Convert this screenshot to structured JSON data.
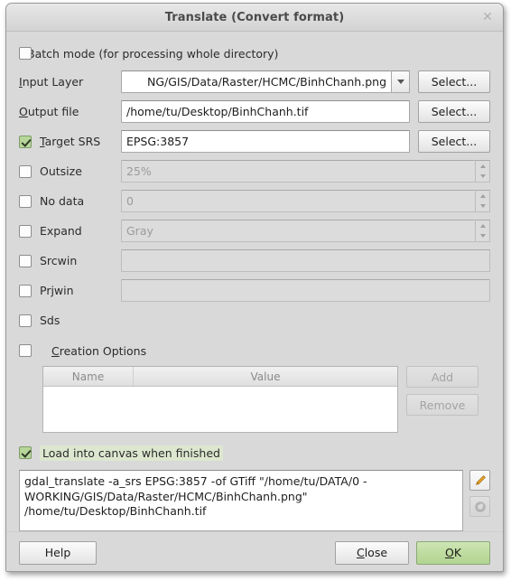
{
  "window": {
    "title": "Translate (Convert format)",
    "close_icon": "close-icon",
    "close_glyph": "✕"
  },
  "form": {
    "batch_mode": {
      "label": "Batch mode (for processing whole directory)",
      "checked": false
    },
    "input_layer": {
      "label": "Input Layer",
      "mnemonic": "I",
      "label_rest": "nput Layer",
      "value": "NG/GIS/Data/Raster/HCMC/BinhChanh.png",
      "select_label": "Select..."
    },
    "output_file": {
      "label": "Output file",
      "mnemonic": "O",
      "label_rest": "utput file",
      "value": "/home/tu/Desktop/BinhChanh.tif",
      "select_label": "Select..."
    },
    "target_srs": {
      "label": "Target SRS",
      "mnemonic": "T",
      "label_rest": "arget SRS",
      "checked": true,
      "value": "EPSG:3857",
      "select_label": "Select..."
    },
    "outsize": {
      "label": "Outsize",
      "checked": false,
      "value": "25%",
      "enabled": false
    },
    "no_data": {
      "label": "No data",
      "checked": false,
      "value": "0",
      "enabled": false
    },
    "expand": {
      "label": "Expand",
      "checked": false,
      "value": "Gray",
      "enabled": false
    },
    "srcwin": {
      "label": "Srcwin",
      "checked": false,
      "value": "",
      "enabled": false
    },
    "prjwin": {
      "label": "Prjwin",
      "checked": false,
      "value": "",
      "enabled": false
    },
    "sds": {
      "label": "Sds",
      "checked": false
    },
    "creation_options": {
      "label": "Creation Options",
      "mnemonic": "C",
      "label_rest": "reation Options",
      "checked": false,
      "columns": [
        "Name",
        "Value"
      ],
      "rows": [],
      "add_label": "Add",
      "remove_label": "Remove",
      "add_enabled": false,
      "remove_enabled": false
    },
    "load_into_canvas": {
      "label": "Load into canvas when finished",
      "mnemonic": "L",
      "label_rest": "oad into canvas when finished",
      "checked": true
    }
  },
  "command": {
    "text": "gdal_translate -a_srs EPSG:3857 -of GTiff \"/home/tu/DATA/0 -WORKING/GIS/Data/Raster/HCMC/BinhChanh.png\" /home/tu/Desktop/BinhChanh.tif",
    "edit_icon": "pencil-icon",
    "reset_icon": "reload-icon"
  },
  "footer": {
    "help_label": "Help",
    "close_label": "Close",
    "close_mnemonic": "C",
    "close_rest": "lose",
    "ok_label": "OK",
    "ok_mnemonic": "O",
    "ok_rest": "K"
  },
  "colors": {
    "dialog_bg": "#d9d9d9",
    "accent_green": "#b7d79a",
    "ok_green": "#bedc9f",
    "highlight_green": "#dde7cf",
    "pencil_orange": "#f0a325"
  }
}
